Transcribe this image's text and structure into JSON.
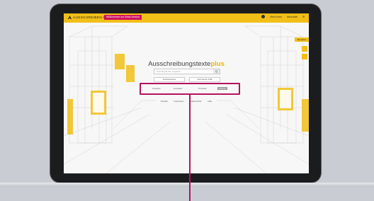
{
  "header": {
    "logo_text": "AUSSCHREIBEN.DE",
    "beta_badge": "Willkommen zur Beta-Version",
    "nav_account": "Mein Konto",
    "nav_notepad": "Merkzettel",
    "nav_menu": "Menü"
  },
  "main": {
    "brand_title": "Ausschreibungstexte",
    "brand_accent": "plus",
    "search_placeholder": "Suchbegriff hier eingeben",
    "search_button": "Q",
    "sub_buttons": [
      "Textbausteine",
      "Normtexte VOB"
    ],
    "filters": [
      "Gewerke",
      "Hersteller",
      "Produkte",
      "Normen"
    ],
    "footer_links": [
      "Kontakt",
      "Impressum",
      "Datenschutz",
      "Hilfe"
    ]
  },
  "side": {
    "tab_label": "Bestellen"
  },
  "colors": {
    "accent": "#f2bf18",
    "highlight": "#b5125f"
  }
}
